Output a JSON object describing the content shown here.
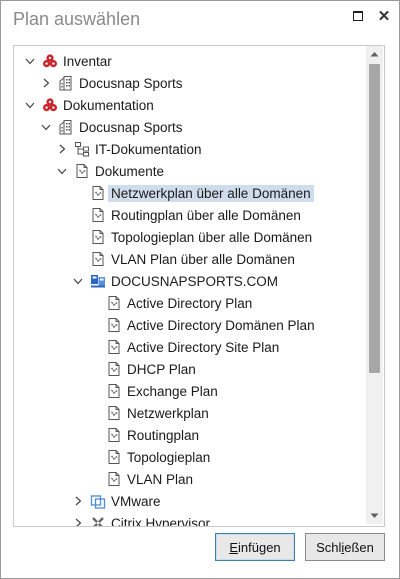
{
  "window": {
    "title": "Plan auswählen"
  },
  "tree": [
    {
      "label": "Inventar",
      "icon": "database-red-icon",
      "toggle": "expanded",
      "depth": 0
    },
    {
      "label": "Docusnap Sports",
      "icon": "building-icon",
      "toggle": "collapsed",
      "depth": 1
    },
    {
      "label": "Dokumentation",
      "icon": "database-red-icon",
      "toggle": "expanded",
      "depth": 0
    },
    {
      "label": "Docusnap Sports",
      "icon": "building-icon",
      "toggle": "expanded",
      "depth": 1
    },
    {
      "label": "IT-Dokumentation",
      "icon": "network-tree-icon",
      "toggle": "collapsed",
      "depth": 2
    },
    {
      "label": "Dokumente",
      "icon": "document-icon",
      "toggle": "expanded",
      "depth": 2
    },
    {
      "label": "Netzwerkplan über alle Domänen",
      "icon": "document-icon",
      "toggle": "none",
      "depth": 3,
      "selected": true
    },
    {
      "label": "Routingplan über alle Domänen",
      "icon": "document-icon",
      "toggle": "none",
      "depth": 3
    },
    {
      "label": "Topologieplan über alle Domänen",
      "icon": "document-icon",
      "toggle": "none",
      "depth": 3
    },
    {
      "label": "VLAN Plan über alle Domänen",
      "icon": "document-icon",
      "toggle": "none",
      "depth": 3
    },
    {
      "label": "DOCUSNAPSPORTS.COM",
      "icon": "domain-icon",
      "toggle": "expanded",
      "depth": 3
    },
    {
      "label": "Active Directory Plan",
      "icon": "document-icon",
      "toggle": "none",
      "depth": 4
    },
    {
      "label": "Active Directory Domänen Plan",
      "icon": "document-icon",
      "toggle": "none",
      "depth": 4
    },
    {
      "label": "Active Directory Site Plan",
      "icon": "document-icon",
      "toggle": "none",
      "depth": 4
    },
    {
      "label": "DHCP Plan",
      "icon": "document-icon",
      "toggle": "none",
      "depth": 4
    },
    {
      "label": "Exchange Plan",
      "icon": "document-icon",
      "toggle": "none",
      "depth": 4
    },
    {
      "label": "Netzwerkplan",
      "icon": "document-icon",
      "toggle": "none",
      "depth": 4
    },
    {
      "label": "Routingplan",
      "icon": "document-icon",
      "toggle": "none",
      "depth": 4
    },
    {
      "label": "Topologieplan",
      "icon": "document-icon",
      "toggle": "none",
      "depth": 4
    },
    {
      "label": "VLAN Plan",
      "icon": "document-icon",
      "toggle": "none",
      "depth": 4
    },
    {
      "label": "VMware",
      "icon": "vmware-icon",
      "toggle": "collapsed",
      "depth": 3
    },
    {
      "label": "Citrix Hypervisor",
      "icon": "citrix-icon",
      "toggle": "collapsed",
      "depth": 3
    }
  ],
  "buttons": {
    "insert": {
      "mnemonic": "E",
      "rest": "infügen"
    },
    "close": {
      "pre": "Schl",
      "mnemonic": "i",
      "rest": "eßen"
    }
  },
  "colors": {
    "selection": "#cfdcec",
    "accent": "#3c7fb1",
    "database_red": "#cc2229",
    "domain_blue": "#2b66c4"
  }
}
